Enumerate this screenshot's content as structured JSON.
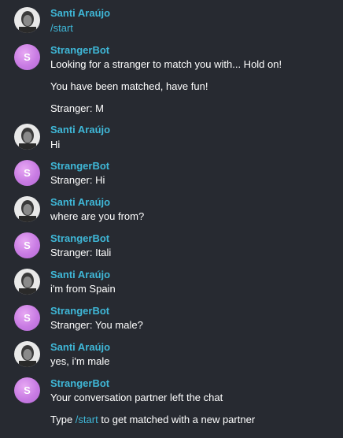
{
  "accent_color": "#3fb8d8",
  "background_color": "#272a31",
  "bot_avatar_color": "#c87be3",
  "messages": [
    {
      "sender": "Santi Araújo",
      "avatar": "user-photo-avatar",
      "lines": [
        "/start"
      ]
    },
    {
      "sender": "StrangerBot",
      "avatar_initial": "S",
      "lines": [
        "Looking for a stranger to match you with... Hold on!",
        "You have been matched, have fun!",
        "Stranger: M"
      ]
    },
    {
      "sender": "Santi Araújo",
      "avatar": "user-photo-avatar",
      "lines": [
        "Hi"
      ]
    },
    {
      "sender": "StrangerBot",
      "avatar_initial": "S",
      "lines": [
        "Stranger: Hi"
      ]
    },
    {
      "sender": "Santi Araújo",
      "avatar": "user-photo-avatar",
      "lines": [
        "where are you from?"
      ]
    },
    {
      "sender": "StrangerBot",
      "avatar_initial": "S",
      "lines": [
        "Stranger: Itali"
      ]
    },
    {
      "sender": "Santi Araújo",
      "avatar": "user-photo-avatar",
      "lines": [
        "i'm from Spain"
      ]
    },
    {
      "sender": "StrangerBot",
      "avatar_initial": "S",
      "lines": [
        "Stranger: You male?"
      ]
    },
    {
      "sender": "Santi Araújo",
      "avatar": "user-photo-avatar",
      "lines": [
        "yes, i'm male"
      ]
    },
    {
      "sender": "StrangerBot",
      "avatar_initial": "S",
      "lines": [
        "Your conversation partner left the chat"
      ]
    }
  ],
  "final_line": {
    "prefix": "Type ",
    "command": "/start",
    "suffix": " to get matched with a new partner"
  }
}
